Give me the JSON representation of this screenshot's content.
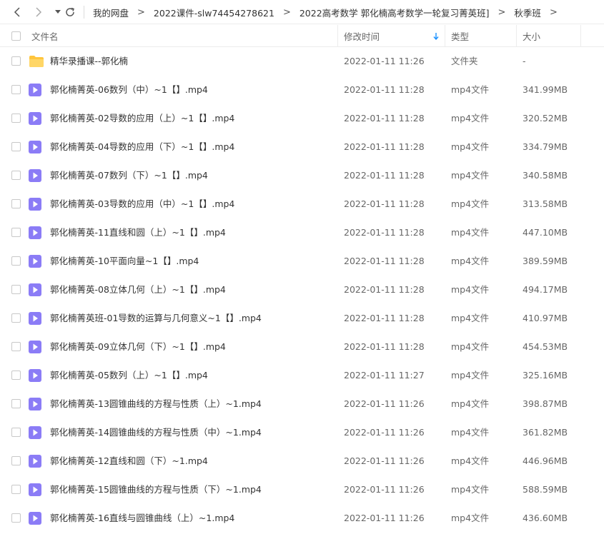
{
  "breadcrumb": {
    "items": [
      "我的网盘",
      "2022课件-slw74454278621",
      "2022高考数学 郭化楠高考数学一轮复习菁英班]",
      "秋季班"
    ],
    "separator": ">"
  },
  "header": {
    "name": "文件名",
    "modified": "修改时间",
    "type": "类型",
    "size": "大小"
  },
  "colors": {
    "accent": "#1890ff",
    "folder": "#ffc53d",
    "video": "#8b7cf6"
  },
  "files": [
    {
      "name": "精华录播课--郭化楠",
      "date": "2022-01-11 11:26",
      "type": "文件夹",
      "size": "-",
      "kind": "folder"
    },
    {
      "name": "郭化楠菁英-06数列（中）~1【】.mp4",
      "date": "2022-01-11 11:28",
      "type": "mp4文件",
      "size": "341.99MB",
      "kind": "video"
    },
    {
      "name": "郭化楠菁英-02导数的应用（上）~1【】.mp4",
      "date": "2022-01-11 11:28",
      "type": "mp4文件",
      "size": "320.52MB",
      "kind": "video"
    },
    {
      "name": "郭化楠菁英-04导数的应用（下）~1【】.mp4",
      "date": "2022-01-11 11:28",
      "type": "mp4文件",
      "size": "334.79MB",
      "kind": "video"
    },
    {
      "name": "郭化楠菁英-07数列（下）~1【】.mp4",
      "date": "2022-01-11 11:28",
      "type": "mp4文件",
      "size": "340.58MB",
      "kind": "video"
    },
    {
      "name": "郭化楠菁英-03导数的应用（中）~1【】.mp4",
      "date": "2022-01-11 11:28",
      "type": "mp4文件",
      "size": "313.58MB",
      "kind": "video"
    },
    {
      "name": "郭化楠菁英-11直线和圆（上）~1【】.mp4",
      "date": "2022-01-11 11:28",
      "type": "mp4文件",
      "size": "447.10MB",
      "kind": "video"
    },
    {
      "name": "郭化楠菁英-10平面向量~1【】.mp4",
      "date": "2022-01-11 11:28",
      "type": "mp4文件",
      "size": "389.59MB",
      "kind": "video"
    },
    {
      "name": "郭化楠菁英-08立体几何（上）~1【】.mp4",
      "date": "2022-01-11 11:28",
      "type": "mp4文件",
      "size": "494.17MB",
      "kind": "video"
    },
    {
      "name": "郭化楠菁英班-01导数的运算与几何意义~1【】.mp4",
      "date": "2022-01-11 11:28",
      "type": "mp4文件",
      "size": "410.97MB",
      "kind": "video"
    },
    {
      "name": "郭化楠菁英-09立体几何（下）~1【】.mp4",
      "date": "2022-01-11 11:28",
      "type": "mp4文件",
      "size": "454.53MB",
      "kind": "video"
    },
    {
      "name": "郭化楠菁英-05数列（上）~1【】.mp4",
      "date": "2022-01-11 11:27",
      "type": "mp4文件",
      "size": "325.16MB",
      "kind": "video"
    },
    {
      "name": "郭化楠菁英-13圆锥曲线的方程与性质（上）~1.mp4",
      "date": "2022-01-11 11:26",
      "type": "mp4文件",
      "size": "398.87MB",
      "kind": "video"
    },
    {
      "name": "郭化楠菁英-14圆锥曲线的方程与性质（中）~1.mp4",
      "date": "2022-01-11 11:26",
      "type": "mp4文件",
      "size": "361.82MB",
      "kind": "video"
    },
    {
      "name": "郭化楠菁英-12直线和圆（下）~1.mp4",
      "date": "2022-01-11 11:26",
      "type": "mp4文件",
      "size": "446.96MB",
      "kind": "video"
    },
    {
      "name": "郭化楠菁英-15圆锥曲线的方程与性质（下）~1.mp4",
      "date": "2022-01-11 11:26",
      "type": "mp4文件",
      "size": "588.59MB",
      "kind": "video"
    },
    {
      "name": "郭化楠菁英-16直线与圆锥曲线（上）~1.mp4",
      "date": "2022-01-11 11:26",
      "type": "mp4文件",
      "size": "436.60MB",
      "kind": "video"
    }
  ]
}
